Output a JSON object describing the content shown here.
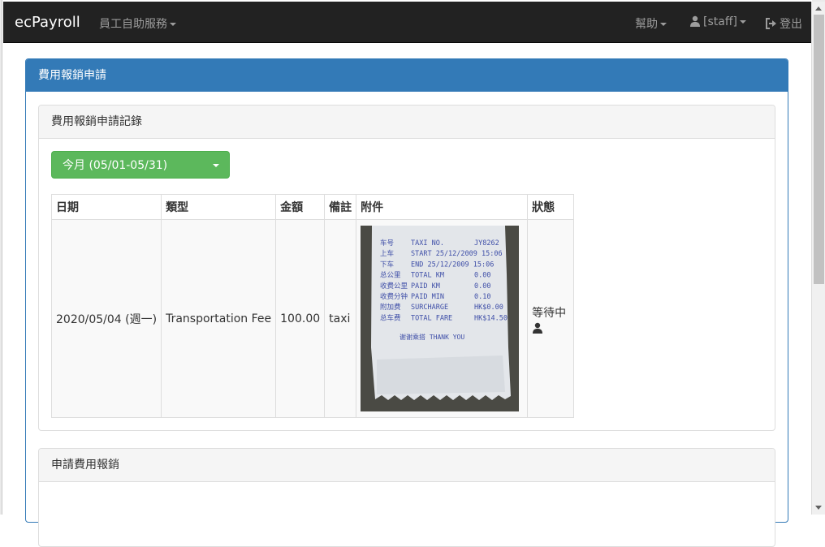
{
  "navbar": {
    "brand": "ecPayroll",
    "menu_self_service": "員工自助服務",
    "menu_help": "幫助",
    "menu_user": "[staff]",
    "menu_logout": "登出"
  },
  "panel": {
    "title": "費用報銷申請",
    "records_title": "費用報銷申請記錄",
    "apply_title": "申請費用報銷"
  },
  "filter": {
    "selected": "今月 (05/01-05/31)"
  },
  "table": {
    "headers": [
      "日期",
      "類型",
      "金額",
      "備註",
      "附件",
      "狀態"
    ],
    "rows": [
      {
        "date": "2020/05/04 (週一)",
        "type": "Transportation Fee",
        "amount": "100.00",
        "note": "taxi",
        "status": "等待中"
      }
    ]
  },
  "receipt": {
    "lines": [
      [
        "车号",
        "TAXI NO.",
        "JY8262"
      ],
      [
        "上车",
        "START 25/12/2009 15:06",
        ""
      ],
      [
        "下车",
        "END  25/12/2009 15:06",
        ""
      ],
      [
        "总公里",
        "TOTAL KM",
        "0.00"
      ],
      [
        "收费公里",
        "PAID KM",
        "0.00"
      ],
      [
        "收费分钟",
        "PAID MIN",
        "0.10"
      ],
      [
        "附加费",
        "SURCHARGE",
        "HK$0.00"
      ],
      [
        "总车费",
        "TOTAL FARE",
        "HK$14.50"
      ]
    ],
    "thanks": "谢谢乘搭   THANK YOU"
  },
  "colors": {
    "navbar_bg": "#222222",
    "primary": "#337ab7",
    "success": "#5cb85c"
  }
}
